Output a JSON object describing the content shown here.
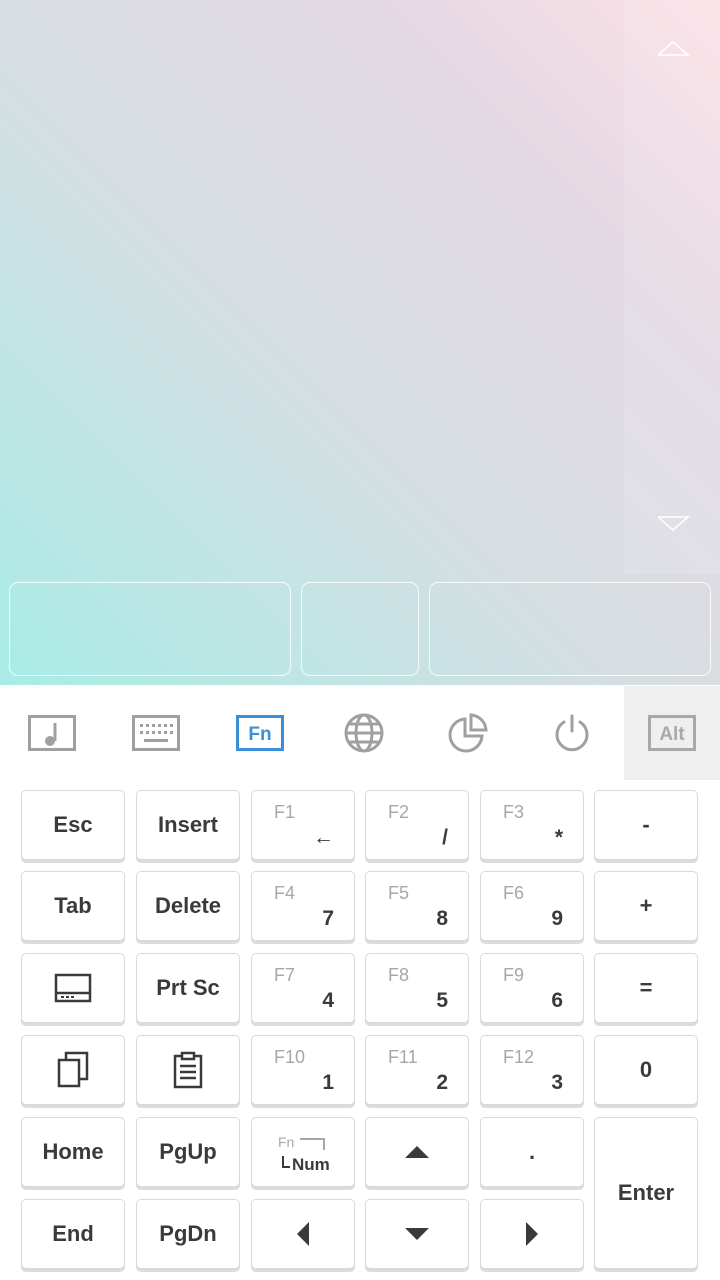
{
  "toolbar": {
    "items": [
      {
        "name": "media-mode",
        "icon": "music-note-icon"
      },
      {
        "name": "keyboard-mode",
        "icon": "keyboard-icon"
      },
      {
        "name": "fn-mode",
        "icon": "fn-icon",
        "label": "Fn",
        "active": true
      },
      {
        "name": "browser-mode",
        "icon": "globe-icon"
      },
      {
        "name": "presentation-mode",
        "icon": "pie-chart-icon"
      },
      {
        "name": "power-mode",
        "icon": "power-icon"
      },
      {
        "name": "alt-toggle",
        "icon": "alt-icon",
        "label": "Alt"
      }
    ],
    "active_color": "#3b8fd6",
    "icon_color": "#a0a0a0"
  },
  "keys": {
    "esc": "Esc",
    "insert": "Insert",
    "f1": "F1",
    "f1_num": "←",
    "f2": "F2",
    "f2_num": "/",
    "f3": "F3",
    "f3_num": "*",
    "minus": "-",
    "tab": "Tab",
    "delete": "Delete",
    "f4": "F4",
    "f4_num": "7",
    "f5": "F5",
    "f5_num": "8",
    "f6": "F6",
    "f6_num": "9",
    "plus": "+",
    "prtsc": "Prt Sc",
    "f7": "F7",
    "f7_num": "4",
    "f8": "F8",
    "f8_num": "5",
    "f9": "F9",
    "f9_num": "6",
    "equals": "=",
    "f10": "F10",
    "f10_num": "1",
    "f11": "F11",
    "f11_num": "2",
    "f12": "F12",
    "f12_num": "3",
    "zero": "0",
    "home": "Home",
    "pgup": "PgUp",
    "fn_toggle_top": "Fn",
    "fn_toggle_bottom": "Num",
    "dot": ".",
    "enter": "Enter",
    "end": "End",
    "pgdn": "PgDn"
  },
  "colors": {
    "touchpad_gradient_start": "#a8ece6",
    "touchpad_gradient_end": "#fddfe6",
    "key_text": "#3a3a3a",
    "fn_text": "#a7a7a7"
  }
}
